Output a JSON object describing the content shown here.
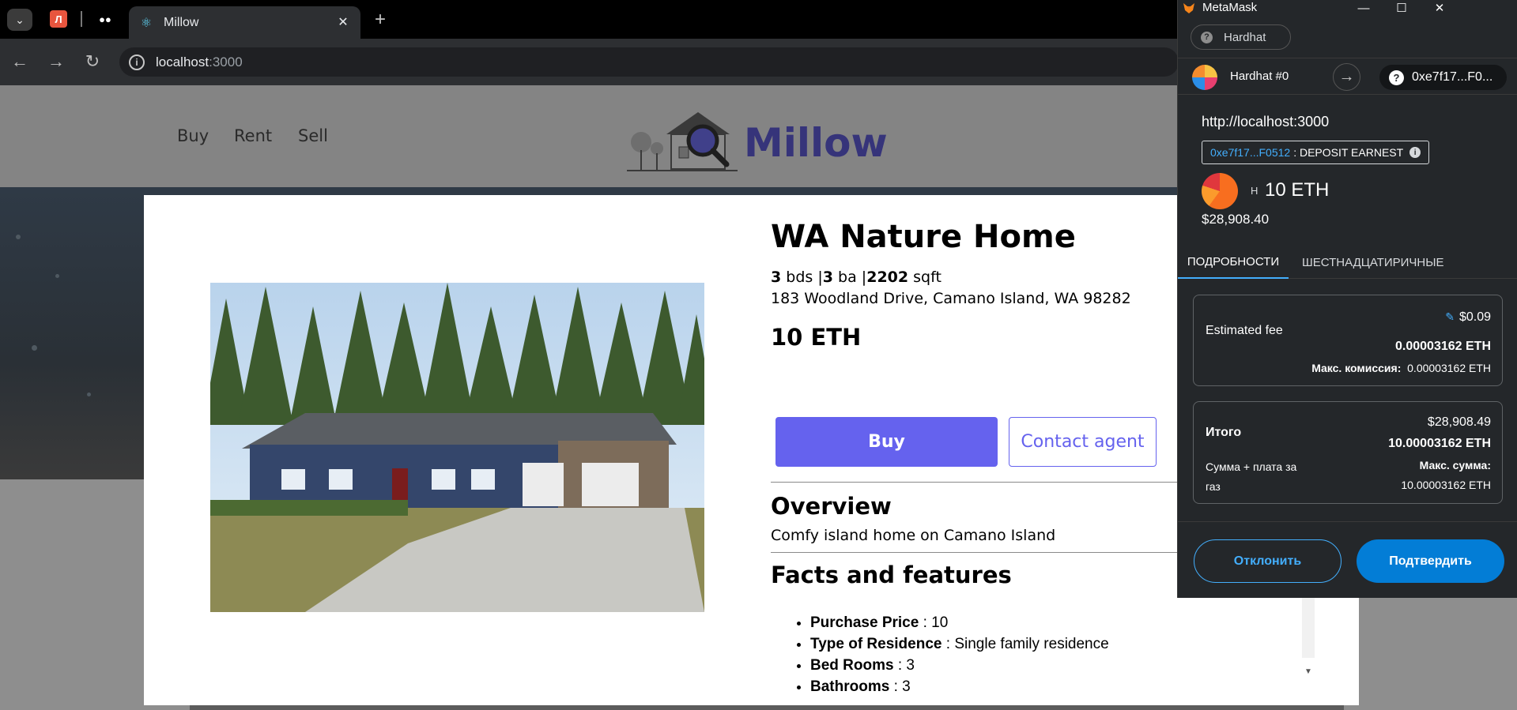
{
  "browser": {
    "pinned_tab_1": "Л",
    "pinned_tab_2": "●●",
    "active_tab_title": "Millow",
    "url_host": "localhost",
    "url_port": ":3000"
  },
  "site": {
    "nav": [
      "Buy",
      "Rent",
      "Sell"
    ],
    "logo_text": "Millow"
  },
  "home": {
    "name": "WA Nature Home",
    "stats": {
      "beds": "3",
      "beds_unit": "bds",
      "baths": "3",
      "baths_unit": "ba",
      "sqft": "2202",
      "sqft_unit": "sqft"
    },
    "address": "183 Woodland Drive, Camano Island, WA 98282",
    "price": "10 ETH",
    "buy_label": "Buy",
    "contact_label": "Contact agent",
    "overview_heading": "Overview",
    "overview_text": "Comfy island home on Camano Island",
    "facts_heading": "Facts and features",
    "facts": [
      {
        "label": "Purchase Price",
        "value": " : 10"
      },
      {
        "label": "Type of Residence",
        "value": " : Single family residence"
      },
      {
        "label": "Bed Rooms",
        "value": " : 3"
      },
      {
        "label": "Bathrooms",
        "value": " : 3"
      }
    ]
  },
  "metamask": {
    "window_title": "MetaMask",
    "network": "Hardhat",
    "account_name": "Hardhat #0",
    "recipient": "0xe7f17...F0...",
    "origin": "http://localhost:3000",
    "method_address": "0xe7f17...F0512",
    "method_name": ": DEPOSIT EARNEST",
    "token_unit": "H",
    "amount": "10 ETH",
    "fiat": "$28,908.40",
    "tabs": [
      "ПОДРОБНОСТИ",
      "ШЕСТНАДЦАТИРИЧНЫЕ"
    ],
    "fee": {
      "label": "Estimated fee",
      "fiat": "$0.09",
      "eth": "0.00003162 ETH",
      "max_label": "Макс. комиссия:",
      "max_value": "0.00003162 ETH"
    },
    "total": {
      "label": "Итого",
      "fiat": "$28,908.49",
      "eth": "10.00003162 ETH",
      "sub_label": "Сумма + плата за газ",
      "max_label": "Макс. сумма:",
      "max_value": "10.00003162 ETH"
    },
    "reject_label": "Отклонить",
    "confirm_label": "Подтвердить",
    "colors": {
      "accent": "#43aefc",
      "confirm": "#037dd6",
      "bg": "#24272a"
    }
  }
}
